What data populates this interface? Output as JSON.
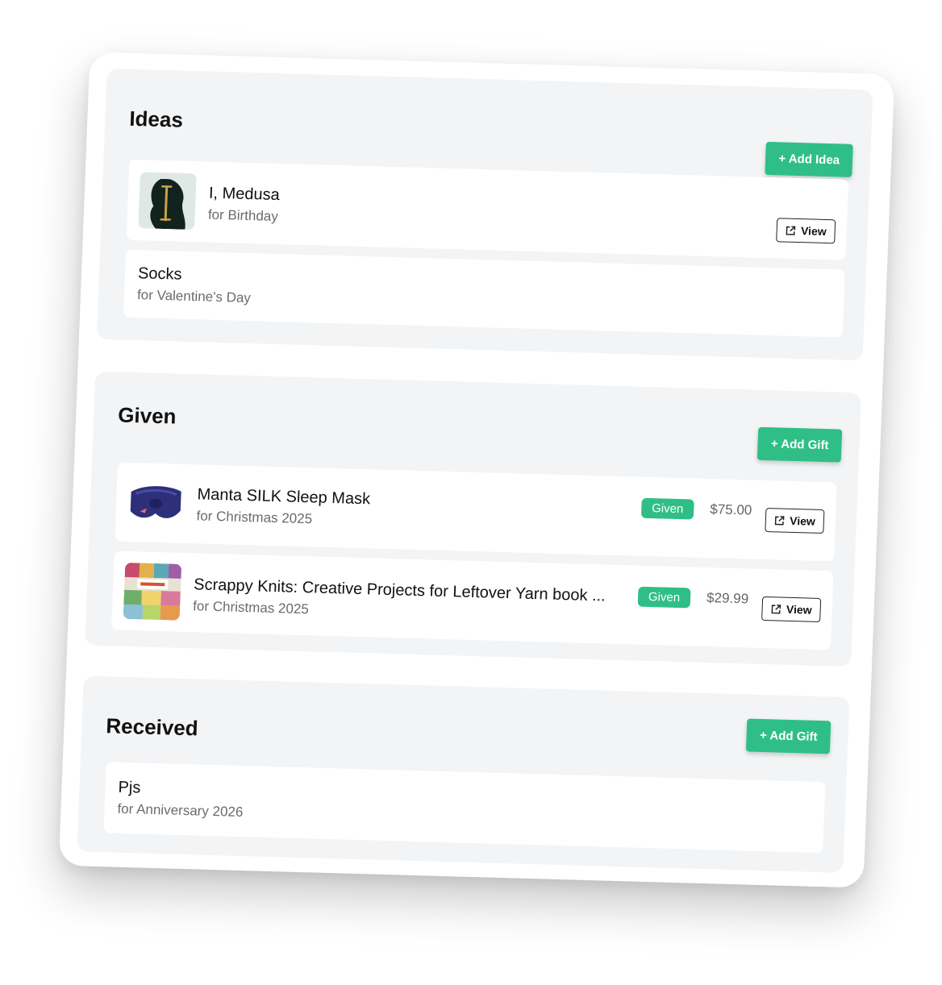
{
  "ideas": {
    "title": "Ideas",
    "add_label": "+ Add Idea",
    "items": [
      {
        "name": "I, Medusa",
        "occasion": "for Birthday",
        "view_label": "View"
      },
      {
        "name": "Socks",
        "occasion": "for Valentine's Day"
      }
    ]
  },
  "given": {
    "title": "Given",
    "add_label": "+ Add Gift",
    "items": [
      {
        "name": "Manta SILK Sleep Mask",
        "occasion": "for Christmas 2025",
        "status": "Given",
        "price": "$75.00",
        "view_label": "View"
      },
      {
        "name": "Scrappy Knits: Creative Projects for Leftover Yarn book ...",
        "occasion": "for Christmas 2025",
        "status": "Given",
        "price": "$29.99",
        "view_label": "View"
      }
    ]
  },
  "received": {
    "title": "Received",
    "add_label": "+ Add Gift",
    "items": [
      {
        "name": "Pjs",
        "occasion": "for Anniversary 2026"
      }
    ]
  },
  "colors": {
    "accent": "#2fbf86",
    "panel": "#f3f4f6",
    "card": "#ffffff"
  }
}
